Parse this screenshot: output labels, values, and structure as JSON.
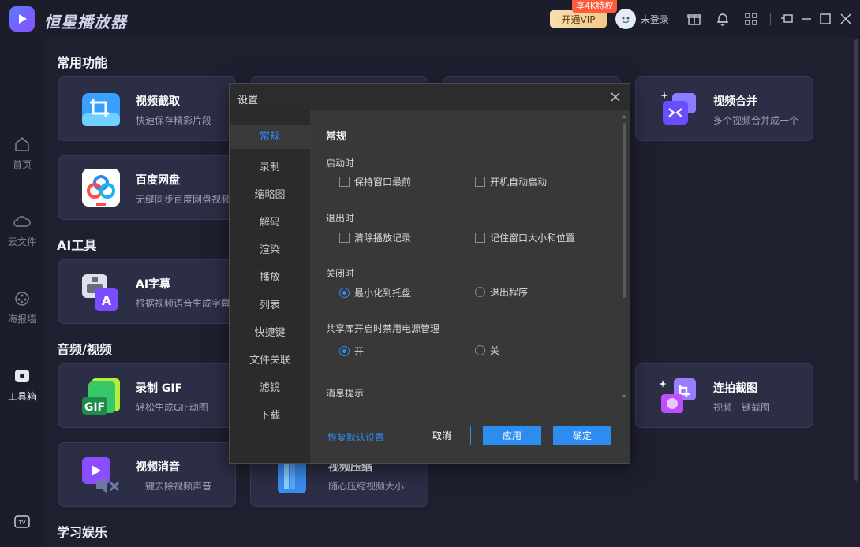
{
  "titlebar": {
    "app_name": "恒星播放器",
    "vip_button": "开通VIP",
    "vip_badge": "享4K特权",
    "login_text": "未登录"
  },
  "leftnav": {
    "items": [
      {
        "label": "首页",
        "icon": "home-icon"
      },
      {
        "label": "云文件",
        "icon": "cloud-icon"
      },
      {
        "label": "海报墙",
        "icon": "film-reel-icon"
      },
      {
        "label": "工具箱",
        "icon": "toolbox-icon"
      }
    ]
  },
  "sections": {
    "common": "常用功能",
    "ai": "AI工具",
    "av": "音频/视频",
    "learn": "学习娱乐"
  },
  "cards": {
    "clip": {
      "title": "视频截取",
      "desc": "快速保存精彩片段"
    },
    "merge": {
      "title": "视频合并",
      "desc": "多个视频合并成一个"
    },
    "baidu": {
      "title": "百度网盘",
      "desc": "无缝同步百度网盘视频"
    },
    "ai_sub": {
      "title": "AI字幕",
      "desc": "根据视频语音生成字幕"
    },
    "gif": {
      "title": "录制 GIF",
      "desc": "轻松生成GIF动图"
    },
    "burst": {
      "title": "连拍截图",
      "desc": "视频一键截图"
    },
    "mute": {
      "title": "视频消音",
      "desc": "一键去除视频声音"
    },
    "compress": {
      "title": "视频压缩",
      "desc": "随心压缩视频大小"
    }
  },
  "dialog": {
    "title": "设置",
    "side_items": [
      "常规",
      "录制",
      "缩略图",
      "解码",
      "渲染",
      "播放",
      "列表",
      "快捷键",
      "文件关联",
      "滤镜",
      "下载"
    ],
    "heading": "常规",
    "startup": {
      "label": "启动时",
      "opt1": "保持窗口最前",
      "opt2": "开机自动启动"
    },
    "exit": {
      "label": "退出时",
      "opt1": "清除播放记录",
      "opt2": "记住窗口大小和位置"
    },
    "close": {
      "label": "关闭时",
      "opt1": "最小化到托盘",
      "opt2": "退出程序"
    },
    "power": {
      "label": "共享库开启时禁用电源管理",
      "opt1": "开",
      "opt2": "关"
    },
    "notify": {
      "label": "消息提示"
    },
    "restore_link": "恢复默认设置",
    "cancel": "取消",
    "apply": "应用",
    "ok": "确定"
  },
  "colors": {
    "accent": "#2d8cf0",
    "vip": "#f0c98a",
    "badge": "#ff5a3c"
  }
}
